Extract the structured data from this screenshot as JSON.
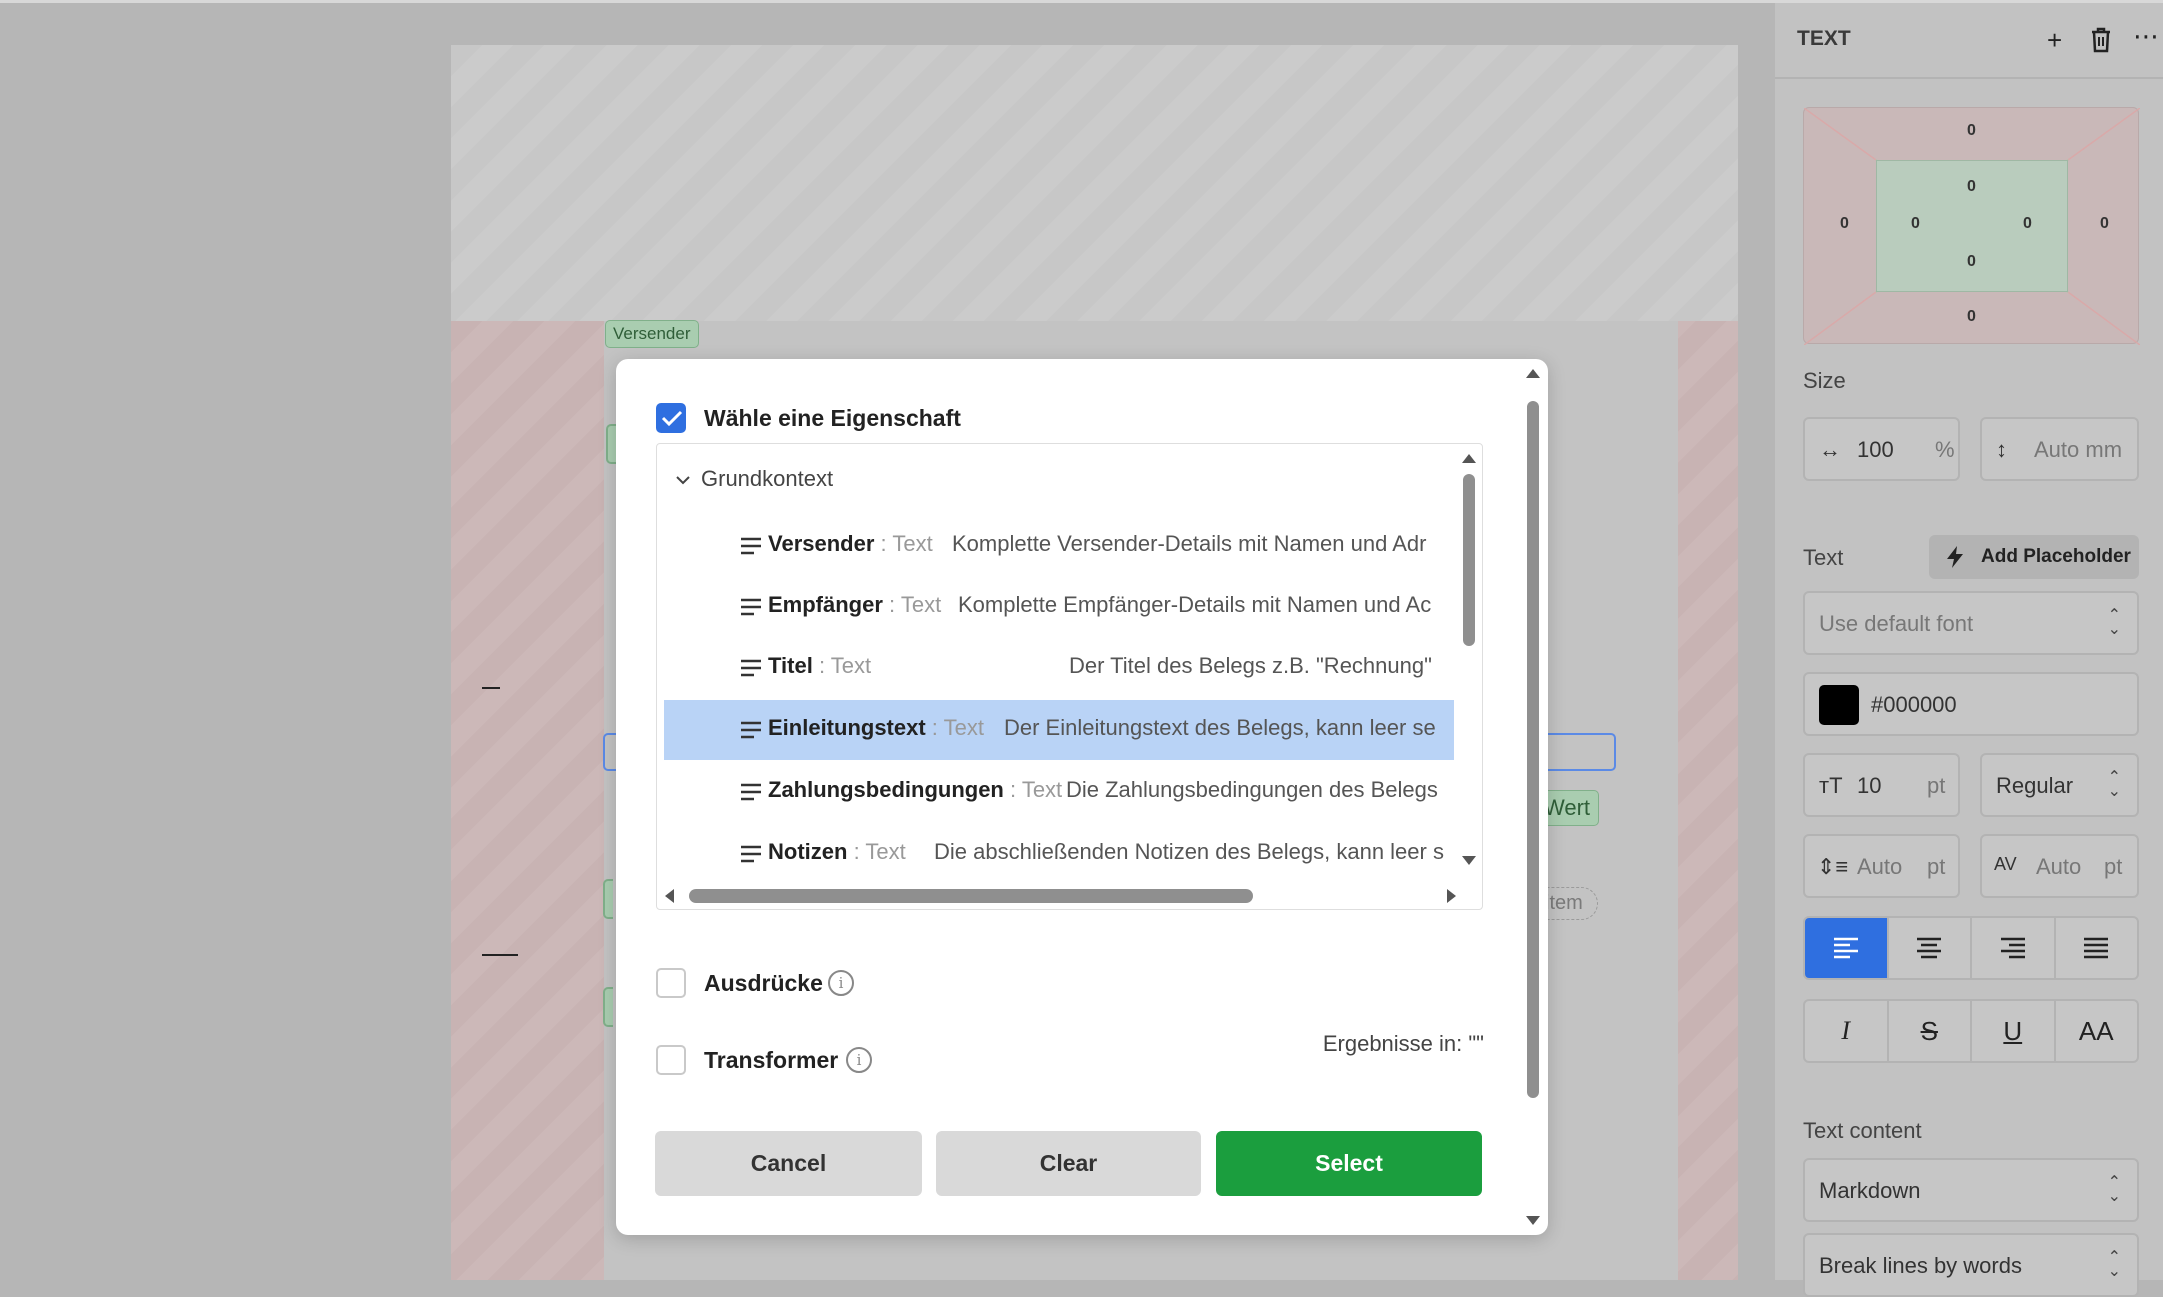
{
  "canvas": {
    "tags": {
      "versender": "Versender",
      "wert": "Wert",
      "item": "item"
    }
  },
  "modal": {
    "header_checkbox_label": "Wähle eine Eigenschaft",
    "header_checked": true,
    "tree": {
      "group_label": "Grundkontext",
      "rows": [
        {
          "name": "Versender",
          "type": " : Text",
          "desc": "Komplette Versender-Details mit Namen und Adr"
        },
        {
          "name": "Empfänger",
          "type": " : Text",
          "desc": "Komplette Empfänger-Details mit Namen und Ac"
        },
        {
          "name": "Titel",
          "type": " : Text",
          "desc": "Der Titel des Belegs z.B. \"Rechnung\""
        },
        {
          "name": "Einleitungstext",
          "type": " : Text",
          "desc": "Der Einleitungstext des Belegs, kann leer se"
        },
        {
          "name": "Zahlungsbedingungen",
          "type": " : Text",
          "desc": "Die Zahlungsbedingungen des Belegs"
        },
        {
          "name": "Notizen",
          "type": " : Text",
          "desc": "Die abschließenden Notizen des Belegs, kann leer s"
        }
      ],
      "selected_index": 3
    },
    "expressions_label": "Ausdrücke",
    "transformer_label": "Transformer",
    "results_label": "Ergebnisse in: \"\"",
    "buttons": {
      "cancel": "Cancel",
      "clear": "Clear",
      "select": "Select"
    }
  },
  "panel": {
    "title": "TEXT",
    "box_model": {
      "margin_top": "0",
      "margin_right": "0",
      "margin_bottom": "0",
      "margin_left": "0",
      "padding_top": "0",
      "padding_right": "0",
      "padding_bottom": "0",
      "padding_left": "0"
    },
    "size_label": "Size",
    "width_value": "100",
    "width_unit": "%",
    "height_value": "Auto mm",
    "text_label": "Text",
    "add_placeholder": "Add Placeholder",
    "font_select": "Use default font",
    "color_value": "#000000",
    "font_size_value": "10",
    "font_size_unit": "pt",
    "font_weight": "Regular",
    "line_height_value": "Auto",
    "line_height_unit": "pt",
    "letter_spacing_value": "Auto",
    "letter_spacing_unit": "pt",
    "text_content_label": "Text content",
    "text_content_select": "Markdown",
    "break_select": "Break lines by words",
    "colors": {
      "accent": "#2f6fe0",
      "select_button": "#1b9e3e"
    }
  }
}
